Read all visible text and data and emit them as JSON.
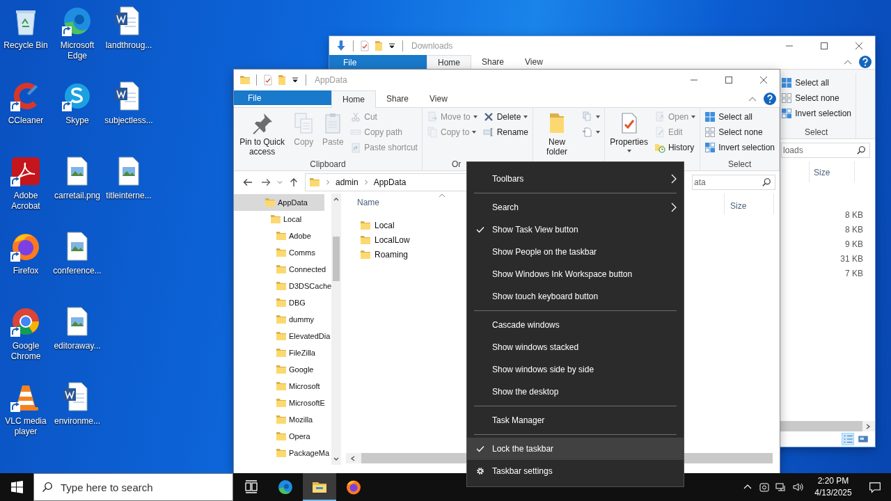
{
  "desktop_icons": [
    {
      "label": "Recycle Bin",
      "kind": "recycle",
      "shortcut": false
    },
    {
      "label": "CCleaner",
      "kind": "ccleaner",
      "shortcut": true
    },
    {
      "label": "Adobe Acrobat",
      "kind": "acrobat",
      "shortcut": true
    },
    {
      "label": "Firefox",
      "kind": "firefox",
      "shortcut": true
    },
    {
      "label": "Google Chrome",
      "kind": "chrome",
      "shortcut": true
    },
    {
      "label": "VLC media player",
      "kind": "vlc",
      "shortcut": true
    },
    {
      "label": "Microsoft Edge",
      "kind": "edge",
      "shortcut": true
    },
    {
      "label": "Skype",
      "kind": "skype",
      "shortcut": true
    },
    {
      "label": "carretail.png",
      "kind": "image",
      "shortcut": false
    },
    {
      "label": "conference...",
      "kind": "image",
      "shortcut": false
    },
    {
      "label": "editoraway...",
      "kind": "image",
      "shortcut": false
    },
    {
      "label": "environme...",
      "kind": "word",
      "shortcut": false
    },
    {
      "label": "landthroug...",
      "kind": "word",
      "shortcut": false
    },
    {
      "label": "subjectless...",
      "kind": "word",
      "shortcut": false
    },
    {
      "label": "titleinterne...",
      "kind": "image",
      "shortcut": false
    }
  ],
  "downloads_window": {
    "title": "Downloads",
    "tabs": [
      {
        "label": "File",
        "kind": "file"
      },
      {
        "label": "Home",
        "kind": "tab",
        "selected": true
      },
      {
        "label": "Share",
        "kind": "tab",
        "selected": false
      },
      {
        "label": "View",
        "kind": "tab",
        "selected": false
      }
    ],
    "ribbon": {
      "groups": [
        {
          "label": "Select",
          "columns": [
            [
              {
                "label": "Select all",
                "kind": "small",
                "disabled": false,
                "dropdown": false
              },
              {
                "label": "Select none",
                "kind": "small",
                "disabled": false,
                "dropdown": false
              },
              {
                "label": "Invert selection",
                "kind": "small",
                "disabled": false,
                "dropdown": false
              }
            ]
          ]
        }
      ]
    },
    "search": {
      "placeholder": "loads"
    },
    "columns": [
      {
        "label": "Size"
      }
    ],
    "sizes": [
      "8 KB",
      "8 KB",
      "9 KB",
      "31 KB",
      "7 KB"
    ],
    "view_modes": [
      {
        "kind": "details",
        "selected": true
      },
      {
        "kind": "thumbnails",
        "selected": false
      }
    ]
  },
  "appdata_window": {
    "title": "AppData",
    "tabs": [
      {
        "label": "File",
        "kind": "file"
      },
      {
        "label": "Home",
        "kind": "tab",
        "selected": true
      },
      {
        "label": "Share",
        "kind": "tab",
        "selected": false
      },
      {
        "label": "View",
        "kind": "tab",
        "selected": false
      }
    ],
    "ribbon": {
      "groups": [
        {
          "label": "Clipboard",
          "columns": [
            [
              {
                "label": "Pin to Quick access",
                "kind": "large",
                "disabled": false,
                "dropdown": false
              }
            ],
            [
              {
                "label": "Copy",
                "kind": "large",
                "disabled": true,
                "dropdown": false
              }
            ],
            [
              {
                "label": "Paste",
                "kind": "large",
                "disabled": true,
                "dropdown": false
              }
            ],
            [
              {
                "label": "Cut",
                "kind": "small",
                "disabled": true,
                "dropdown": false
              },
              {
                "label": "Copy path",
                "kind": "small",
                "disabled": true,
                "dropdown": false
              },
              {
                "label": "Paste shortcut",
                "kind": "small",
                "disabled": true,
                "dropdown": false
              }
            ]
          ]
        },
        {
          "label": "Or",
          "columns": [
            [
              {
                "label": "Move to",
                "kind": "small",
                "disabled": true,
                "dropdown": true
              },
              {
                "label": "Copy to",
                "kind": "small",
                "disabled": true,
                "dropdown": true
              }
            ],
            [
              {
                "label": "Delete",
                "kind": "small",
                "disabled": false,
                "dropdown": true
              },
              {
                "label": "Rename",
                "kind": "small",
                "disabled": false,
                "dropdown": false
              }
            ]
          ]
        },
        {
          "columns": [
            [
              {
                "label": "New folder",
                "kind": "large",
                "disabled": false,
                "dropdown": false
              }
            ],
            [
              {
                "kind": "small",
                "disabled": false,
                "dropdown": true
              },
              {
                "kind": "small",
                "disabled": false,
                "dropdown": true
              }
            ]
          ]
        },
        {
          "columns": [
            [
              {
                "label": "Properties",
                "kind": "large",
                "disabled": false,
                "dropdown": true
              }
            ],
            [
              {
                "label": "Open",
                "kind": "small",
                "disabled": true,
                "dropdown": true
              },
              {
                "label": "Edit",
                "kind": "small",
                "disabled": true,
                "dropdown": false
              },
              {
                "label": "History",
                "kind": "small",
                "disabled": false,
                "dropdown": false
              }
            ]
          ]
        },
        {
          "label": "Select",
          "columns": [
            [
              {
                "label": "Select all",
                "kind": "small",
                "disabled": false,
                "dropdown": false
              },
              {
                "label": "Select none",
                "kind": "small",
                "disabled": false,
                "dropdown": false
              },
              {
                "label": "Invert selection",
                "kind": "small",
                "disabled": false,
                "dropdown": false
              }
            ]
          ]
        }
      ]
    },
    "breadcrumbs": [
      "admin",
      "AppData"
    ],
    "search": {
      "placeholder": "ata"
    },
    "tree": [
      {
        "label": "AppData",
        "selected": true,
        "children": [
          {
            "label": "Local",
            "selected": false,
            "children": [
              {
                "label": "Adobe",
                "selected": false
              },
              {
                "label": "Comms",
                "selected": false
              },
              {
                "label": "Connected",
                "selected": false
              },
              {
                "label": "D3DSCache",
                "selected": false
              },
              {
                "label": "DBG",
                "selected": false
              },
              {
                "label": "dummy",
                "selected": false
              },
              {
                "label": "ElevatedDia",
                "selected": false
              },
              {
                "label": "FileZilla",
                "selected": false
              },
              {
                "label": "Google",
                "selected": false
              },
              {
                "label": "Microsoft",
                "selected": false
              },
              {
                "label": "MicrosoftE",
                "selected": false
              },
              {
                "label": "Mozilla",
                "selected": false
              },
              {
                "label": "Opera",
                "selected": false
              },
              {
                "label": "PackageMa",
                "selected": false
              }
            ]
          }
        ]
      }
    ],
    "columns": [
      {
        "label": "Name",
        "sorted": true
      },
      {
        "label": "Size",
        "sorted": false
      }
    ],
    "files": [
      {
        "name": "Local"
      },
      {
        "name": "LocalLow"
      },
      {
        "name": "Roaming"
      }
    ]
  },
  "context_menu": {
    "groups": [
      {
        "items": [
          {
            "label": "Toolbars",
            "kind": "item",
            "checked": false,
            "submenu": true,
            "highlighted": false
          }
        ]
      },
      {
        "items": [
          {
            "label": "Search",
            "kind": "item",
            "checked": false,
            "submenu": true,
            "highlighted": false
          },
          {
            "label": "Show Task View button",
            "kind": "item",
            "checked": true,
            "submenu": false,
            "highlighted": false
          },
          {
            "label": "Show People on the taskbar",
            "kind": "item",
            "checked": false,
            "submenu": false,
            "highlighted": false
          },
          {
            "label": "Show Windows Ink Workspace button",
            "kind": "item",
            "checked": false,
            "submenu": false,
            "highlighted": false
          },
          {
            "label": "Show touch keyboard button",
            "kind": "item",
            "checked": false,
            "submenu": false,
            "highlighted": false
          }
        ]
      },
      {
        "items": [
          {
            "label": "Cascade windows",
            "kind": "item",
            "checked": false,
            "submenu": false,
            "highlighted": false
          },
          {
            "label": "Show windows stacked",
            "kind": "item",
            "checked": false,
            "submenu": false,
            "highlighted": false
          },
          {
            "label": "Show windows side by side",
            "kind": "item",
            "checked": false,
            "submenu": false,
            "highlighted": false
          },
          {
            "label": "Show the desktop",
            "kind": "item",
            "checked": false,
            "submenu": false,
            "highlighted": false
          }
        ]
      },
      {
        "items": [
          {
            "label": "Task Manager",
            "kind": "item",
            "checked": false,
            "submenu": false,
            "highlighted": false
          }
        ]
      },
      {
        "items": [
          {
            "label": "Lock the taskbar",
            "kind": "item",
            "checked": true,
            "submenu": false,
            "highlighted": true
          },
          {
            "label": "Taskbar settings",
            "kind": "settings",
            "checked": false,
            "submenu": false,
            "highlighted": false
          }
        ]
      }
    ]
  },
  "taskbar": {
    "search": {
      "placeholder": "Type here to search"
    },
    "apps": [
      {
        "kind": "taskview",
        "active": false
      },
      {
        "kind": "edge",
        "active": false
      },
      {
        "kind": "explorer",
        "active": true
      },
      {
        "kind": "firefox",
        "active": false
      }
    ],
    "time": "2:20 PM",
    "date": "4/13/2025"
  }
}
